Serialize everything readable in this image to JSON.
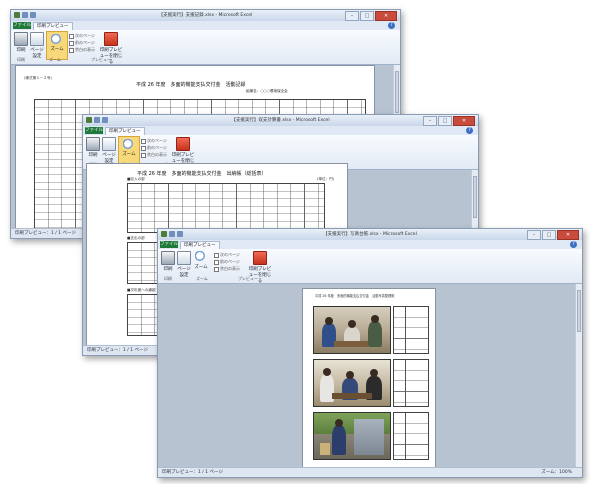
{
  "windows": [
    {
      "id": "win1",
      "title": "【支援実行】支援記録.xlsx - Microsoft Excel",
      "tab_file": "ファイル",
      "tab_active": "印刷プレビュー",
      "ribbon": {
        "print_label": "印刷",
        "page_setup_label": "ページ設定",
        "zoom_label": "ズーム",
        "next_page": "次のページ",
        "prev_page": "前のページ",
        "show_margins": "余白の表示",
        "close_label": "印刷プレビューを閉じる",
        "group_print": "印刷",
        "group_zoom": "ズーム",
        "group_preview": "プレビュー"
      },
      "document": {
        "form_no": "(様式第１－２号)",
        "heading": "平成 26 年度　多面的機能支払交付金　活動記録",
        "org": "組織名：○○○環境保全会"
      },
      "status": "印刷プレビュー：1 / 1 ページ"
    },
    {
      "id": "win2",
      "title": "【支援実行】収支計算書.xlsx - Microsoft Excel",
      "tab_file": "ファイル",
      "tab_active": "印刷プレビュー",
      "ribbon": {
        "print_label": "印刷",
        "page_setup_label": "ページ設定",
        "zoom_label": "ズーム",
        "next_page": "次のページ",
        "prev_page": "前のページ",
        "show_margins": "余白の表示",
        "close_label": "印刷プレビューを閉じる",
        "group_print": "印刷",
        "group_zoom": "ズーム",
        "group_preview": "プレビュー"
      },
      "document": {
        "heading": "平成 26 年度　多面的機能支払交付金　出納帳（総括表）",
        "unit": "(単位：円)",
        "section1": "■収入の部",
        "section2": "■支出の部",
        "section3": "■次年度への繰越"
      },
      "status": "印刷プレビュー：1 / 1 ページ"
    },
    {
      "id": "win3",
      "title": "【支援実行】写真台帳.xlsx - Microsoft Excel",
      "tab_file": "ファイル",
      "tab_active": "印刷プレビュー",
      "ribbon": {
        "print_label": "印刷",
        "page_setup_label": "ページ設定",
        "zoom_label": "ズーム",
        "next_page": "次のページ",
        "prev_page": "前のページ",
        "show_margins": "余白の表示",
        "close_label": "印刷プレビューを閉じる",
        "group_print": "印刷",
        "group_zoom": "ズーム",
        "group_preview": "プレビュー"
      },
      "document": {
        "heading": "平成 26 年度　多面的機能支払交付金　活動写真整理帳"
      },
      "status": "印刷プレビュー：1 / 1 ページ",
      "zoom_level": "ズーム：100%"
    }
  ]
}
